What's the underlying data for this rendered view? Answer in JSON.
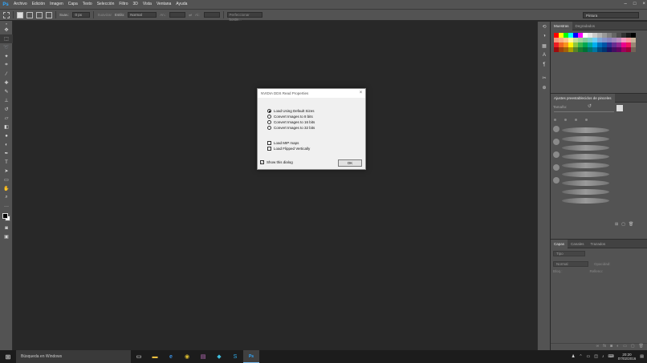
{
  "menu": {
    "logo": "Ps",
    "items": [
      "Archivo",
      "Edición",
      "Imagen",
      "Capa",
      "Texto",
      "Selección",
      "Filtro",
      "3D",
      "Vista",
      "Ventana",
      "Ayuda"
    ],
    "window_controls": [
      "–",
      "□",
      "×"
    ]
  },
  "options": {
    "feather_label": "Suav.:",
    "feather_value": "0 px",
    "antialias_label": "Suavizar",
    "style_label": "Estilo:",
    "style_value": "Normal",
    "width_label": "An.:",
    "height_label": "Al.:",
    "refine_label": "Perfeccionar borde...",
    "workspace_value": "Pintura"
  },
  "panels": {
    "swatches_tabs": [
      "Muestras",
      "Degradados"
    ],
    "brush_presets_title": "Ajustes preestablecidos de pinceles",
    "brush_size_label": "Tamaño:",
    "layers_tabs": [
      "Capas",
      "Canales",
      "Trazados"
    ],
    "layers_kind_placeholder": "Tipo",
    "layers_blend_placeholder": "Normal",
    "layers_opacity_label": "Opacidad:",
    "layers_fill_label": "Relleno:",
    "layers_lock_label": "Bloq.:"
  },
  "swatches": [
    "#ff0000",
    "#ffff00",
    "#00ff00",
    "#00ffff",
    "#0000ff",
    "#ff00ff",
    "#ffffff",
    "#e6e6e6",
    "#cccccc",
    "#b3b3b3",
    "#999999",
    "#808080",
    "#666666",
    "#4d4d4d",
    "#333333",
    "#1a1a1a",
    "#000000",
    "#f7977a",
    "#f9ad81",
    "#fdc68a",
    "#fff79a",
    "#c4df9b",
    "#a2d39c",
    "#82ca9d",
    "#7bcdc8",
    "#6ecff6",
    "#7ea7d8",
    "#8493ca",
    "#8882be",
    "#a187be",
    "#bc8dbf",
    "#f49ac2",
    "#f6989d",
    "#c7b299",
    "#ed1c24",
    "#f26522",
    "#f7941d",
    "#fff200",
    "#8dc63f",
    "#39b54a",
    "#00a651",
    "#00a99d",
    "#00aeef",
    "#0072bc",
    "#0054a6",
    "#2e3192",
    "#662d91",
    "#92278f",
    "#ec008c",
    "#ed145b",
    "#998675",
    "#9e0b0f",
    "#a0410d",
    "#a36209",
    "#aba000",
    "#598527",
    "#1a7b30",
    "#007236",
    "#00746b",
    "#0076a3",
    "#004a80",
    "#003471",
    "#1b1464",
    "#440e62",
    "#630460",
    "#9e005d",
    "#9e0039",
    "#736357"
  ],
  "dialog": {
    "title": "NVIDIA DDS Read Properties",
    "close_label": "×",
    "options": [
      {
        "label": "Load Using Default Sizes",
        "checked": true
      },
      {
        "label": "Convert Images to 8 bits",
        "checked": false
      },
      {
        "label": "Convert Images to 16 bits",
        "checked": false
      },
      {
        "label": "Convert Images to 32 bits",
        "checked": false
      }
    ],
    "load_mip_label": "Load MIP maps",
    "load_flipped_label": "Load Flipped Vertically",
    "show_dialog_label": "Show this dialog",
    "ok_label": "OK"
  },
  "taskbar": {
    "search_placeholder": "Búsqueda en Windows",
    "time": "20:20",
    "date": "07/02/2016"
  }
}
